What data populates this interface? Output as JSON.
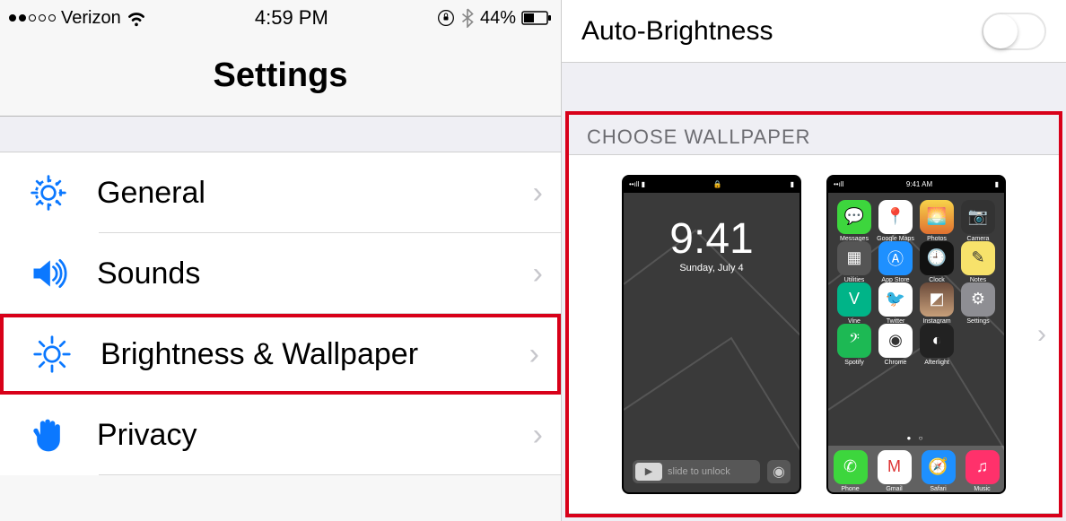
{
  "statusbar": {
    "carrier": "Verizon",
    "time": "4:59 PM",
    "battery_pct": "44%"
  },
  "header": {
    "title": "Settings"
  },
  "rows": {
    "general": "General",
    "sounds": "Sounds",
    "brightness": "Brightness & Wallpaper",
    "privacy": "Privacy"
  },
  "right": {
    "auto_brightness": "Auto-Brightness",
    "choose_wallpaper": "CHOOSE WALLPAPER"
  },
  "lockscreen": {
    "time": "9:41",
    "date": "Sunday, July 4",
    "slide": "slide to unlock"
  },
  "homescreen": {
    "sb_time": "9:41 AM",
    "apps_r1": [
      "Messages",
      "Google Maps",
      "Photos",
      "Camera"
    ],
    "apps_r2": [
      "Utilities",
      "App Store",
      "Clock",
      "Notes"
    ],
    "apps_r3": [
      "Vine",
      "Twitter",
      "Instagram",
      "Settings"
    ],
    "apps_r4": [
      "Spotify",
      "Chrome",
      "Afterlight",
      ""
    ],
    "dock": [
      "Phone",
      "Gmail",
      "Safari",
      "Music"
    ]
  }
}
